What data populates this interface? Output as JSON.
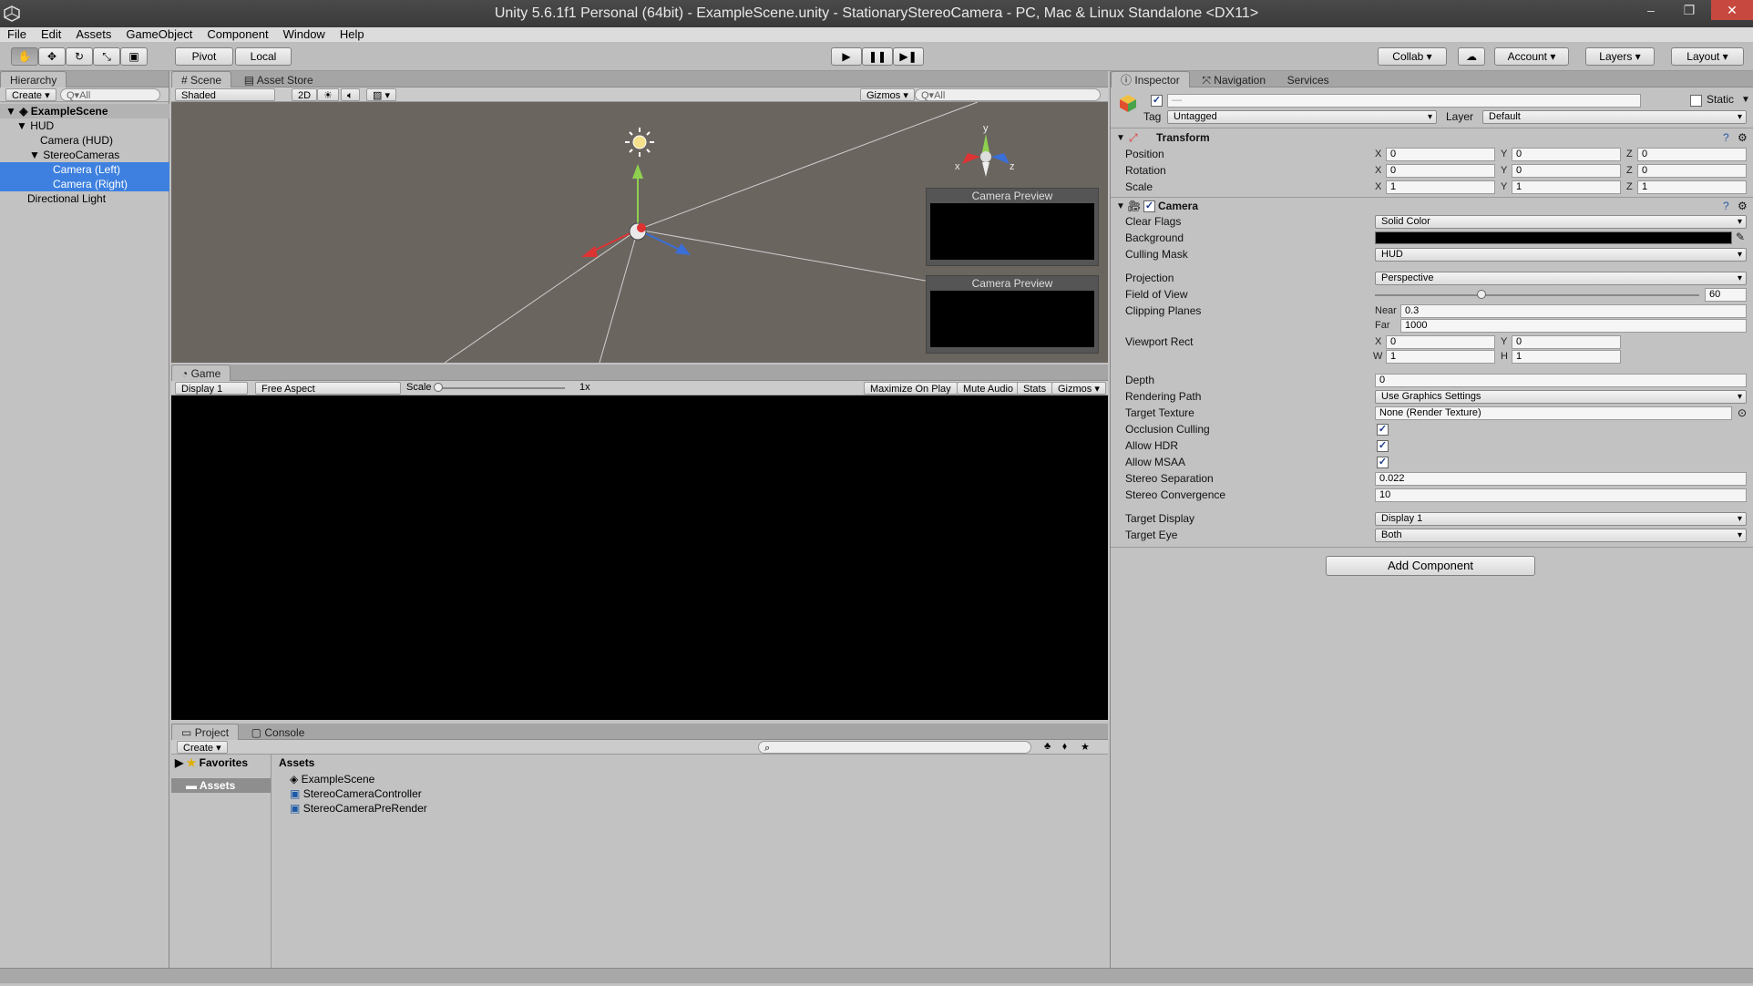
{
  "window": {
    "title": "Unity 5.6.1f1 Personal (64bit) - ExampleScene.unity - StationaryStereoCamera - PC, Mac & Linux Standalone <DX11>",
    "minimize": "–",
    "maximize": "❐",
    "close": "✕"
  },
  "menu": [
    "File",
    "Edit",
    "Assets",
    "GameObject",
    "Component",
    "Window",
    "Help"
  ],
  "toolbar": {
    "pivot": "Pivot",
    "local": "Local",
    "collab": "Collab",
    "account": "Account",
    "layers": "Layers",
    "layout": "Layout"
  },
  "hierarchy": {
    "tab": "Hierarchy",
    "create": "Create",
    "search_placeholder": "Q▾All",
    "scene": "ExampleScene",
    "items": [
      {
        "label": "HUD"
      },
      {
        "label": "Camera (HUD)"
      },
      {
        "label": "StereoCameras"
      },
      {
        "label": "Camera (Left)"
      },
      {
        "label": "Camera (Right)"
      },
      {
        "label": "Directional Light"
      }
    ]
  },
  "scene": {
    "tab_scene": "Scene",
    "tab_store": "Asset Store",
    "shading": "Shaded",
    "mode_2d": "2D",
    "gizmos": "Gizmos",
    "search_placeholder": "Q▾All",
    "preview1": "Camera Preview",
    "preview2": "Camera Preview",
    "axis_x": "x",
    "axis_y": "y",
    "axis_z": "z"
  },
  "game": {
    "tab": "Game",
    "display": "Display 1",
    "aspect": "Free Aspect",
    "scale_label": "Scale",
    "scale_value": "1x",
    "maximize": "Maximize On Play",
    "mute": "Mute Audio",
    "stats": "Stats",
    "gizmos": "Gizmos"
  },
  "project": {
    "tab_project": "Project",
    "tab_console": "Console",
    "create": "Create",
    "favorites": "Favorites",
    "assets_folder": "Assets",
    "assets_header": "Assets",
    "files": [
      "ExampleScene",
      "StereoCameraController",
      "StereoCameraPreRender"
    ]
  },
  "inspector": {
    "tab_inspector": "Inspector",
    "tab_navigation": "Navigation",
    "tab_services": "Services",
    "name": "—",
    "static": "Static",
    "tag_label": "Tag",
    "tag": "Untagged",
    "layer_label": "Layer",
    "layer": "Default",
    "transform": {
      "title": "Transform",
      "position": "Position",
      "rotation": "Rotation",
      "scale": "Scale",
      "pos": [
        "0",
        "0",
        "0"
      ],
      "rot": [
        "0",
        "0",
        "0"
      ],
      "scl": [
        "1",
        "1",
        "1"
      ]
    },
    "camera": {
      "title": "Camera",
      "clear_flags": "Clear Flags",
      "clear_flags_val": "Solid Color",
      "background": "Background",
      "culling_mask": "Culling Mask",
      "culling_mask_val": "HUD",
      "projection": "Projection",
      "projection_val": "Perspective",
      "fov": "Field of View",
      "fov_val": "60",
      "fov_fraction": 0.33,
      "clipping": "Clipping Planes",
      "near": "Near",
      "near_val": "0.3",
      "far": "Far",
      "far_val": "1000",
      "viewport": "Viewport Rect",
      "vp_x": "0",
      "vp_y": "0",
      "vp_w": "1",
      "vp_h": "1",
      "depth": "Depth",
      "depth_val": "0",
      "rendering_path": "Rendering Path",
      "rendering_path_val": "Use Graphics Settings",
      "target_texture": "Target Texture",
      "target_texture_val": "None (Render Texture)",
      "occlusion": "Occlusion Culling",
      "hdr": "Allow HDR",
      "msaa": "Allow MSAA",
      "stereo_sep": "Stereo Separation",
      "stereo_sep_val": "0.022",
      "stereo_conv": "Stereo Convergence",
      "stereo_conv_val": "10",
      "target_display": "Target Display",
      "target_display_val": "Display 1",
      "target_eye": "Target Eye",
      "target_eye_val": "Both"
    },
    "add_component": "Add Component"
  },
  "colors": {
    "selection": "#3d80df",
    "scene_bg": "#6b6560",
    "panel": "#c2c2c2"
  }
}
